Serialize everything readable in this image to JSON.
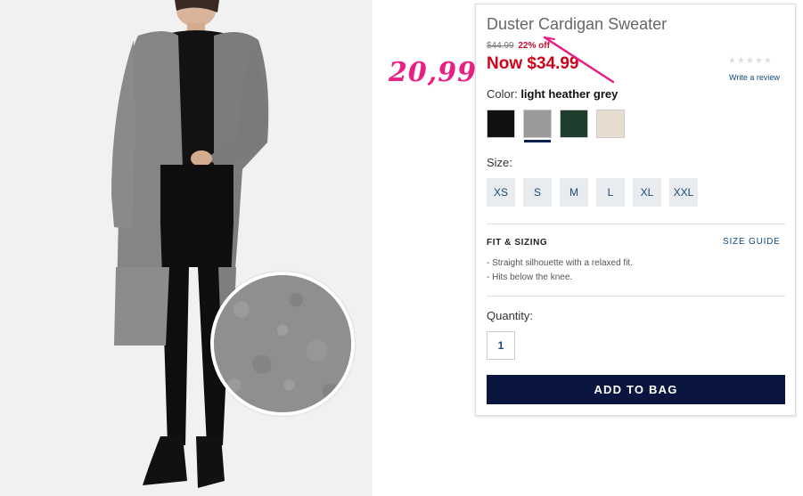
{
  "product": {
    "title": "Duster Cardigan Sweater",
    "original_price": "$44.99",
    "discount": "22% off",
    "current_price": "Now $34.99",
    "rating_stars": "★★★★★",
    "review_link": "Write a review"
  },
  "annotation": {
    "handwritten_price": "20,99",
    "color": "#ea1f84"
  },
  "color_select": {
    "label": "Color:",
    "selected_value": "light heather grey",
    "swatches": [
      {
        "name": "black",
        "color": "#111111"
      },
      {
        "name": "light heather grey",
        "color": "#9a9a9a",
        "selected": true
      },
      {
        "name": "green",
        "color": "#1f3d2c"
      },
      {
        "name": "oatmeal",
        "color": "#e6ddd0"
      }
    ]
  },
  "size_select": {
    "label": "Size:",
    "options": [
      "XS",
      "S",
      "M",
      "L",
      "XL",
      "XXL"
    ]
  },
  "fit": {
    "heading": "FIT & SIZING",
    "size_guide": "SIZE GUIDE",
    "items": [
      "- Straight silhouette with a relaxed fit.",
      "- Hits below the knee."
    ]
  },
  "quantity": {
    "label": "Quantity:",
    "value": "1"
  },
  "cta": {
    "add_to_bag": "ADD TO BAG"
  },
  "colors": {
    "sale_red": "#d0021b",
    "navy": "#0b1640",
    "link_blue": "#0f4c81"
  }
}
